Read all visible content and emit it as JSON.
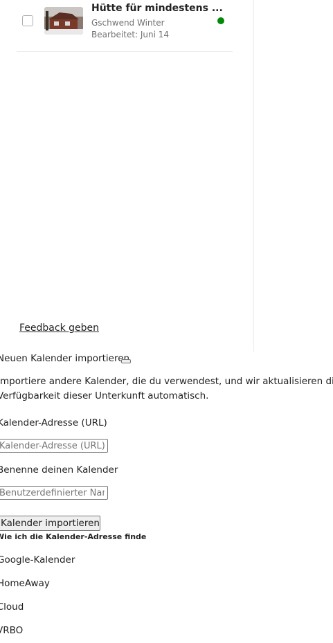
{
  "listing": {
    "title": "Hütte für mindestens ...",
    "subtitle": "Gschwend Winter",
    "edited": "Bearbeitet: Juni 14",
    "status_color": "#008a05"
  },
  "feedback_link": "Feedback geben",
  "import": {
    "heading": "Neuen Kalender importieren",
    "description_line1": "Importiere andere Kalender, die du verwendest, und wir aktualisieren die",
    "description_line2": "Verfügbarkeit dieser Unterkunft automatisch.",
    "url_label": "Kalender-Adresse (URL)",
    "url_placeholder": "Kalender-Adresse (URL)",
    "url_value": "",
    "name_label": "Benenne deinen Kalender",
    "name_placeholder": "Benutzerdefinierter Name",
    "name_value": "",
    "submit_label": "Kalender importieren",
    "help_heading": "Wie ich die Kalender-Adresse finde",
    "providers": [
      "Google-Kalender",
      "HomeAway",
      "iCloud",
      "VRBO"
    ]
  }
}
